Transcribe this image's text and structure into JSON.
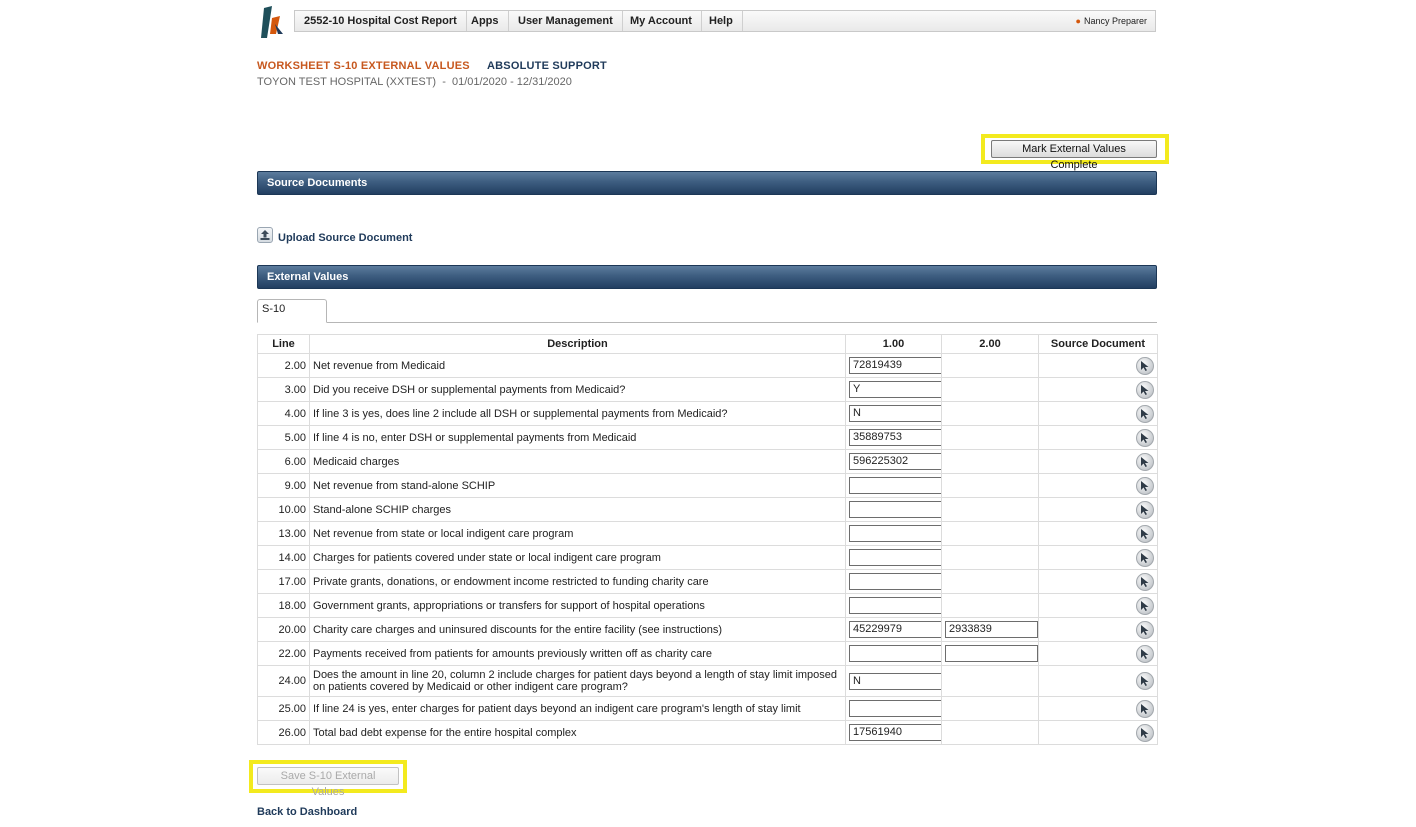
{
  "nav": {
    "app_title": "2552-10 Hospital Cost Report",
    "items": [
      "Apps",
      "User Management",
      "My Account",
      "Help"
    ],
    "user": "Nancy Preparer"
  },
  "header": {
    "worksheet_title": "WORKSHEET S-10 EXTERNAL VALUES",
    "subtitle": "ABSOLUTE SUPPORT",
    "hospital_line": "TOYON TEST HOSPITAL (XXTEST)  -  01/01/2020 - 12/31/2020"
  },
  "mark_complete_label": "Mark External Values Complete",
  "source_documents": {
    "title": "Source Documents",
    "upload_label": "Upload Source Document"
  },
  "external_values": {
    "title": "External Values",
    "tab_label": "S-10",
    "columns": [
      "Line",
      "Description",
      "1.00",
      "2.00",
      "Source Document"
    ],
    "rows": [
      {
        "line": "2.00",
        "desc": "Net revenue from Medicaid",
        "c1": "72819439",
        "c2": null
      },
      {
        "line": "3.00",
        "desc": "Did you receive DSH or supplemental payments from Medicaid?",
        "c1": "Y",
        "c2": null
      },
      {
        "line": "4.00",
        "desc": "If line 3 is yes, does line 2 include all DSH or supplemental payments from Medicaid?",
        "c1": "N",
        "c2": null
      },
      {
        "line": "5.00",
        "desc": "If line 4 is no, enter DSH or supplemental payments from Medicaid",
        "c1": "35889753",
        "c2": null
      },
      {
        "line": "6.00",
        "desc": "Medicaid charges",
        "c1": "596225302",
        "c2": null
      },
      {
        "line": "9.00",
        "desc": "Net revenue from stand-alone SCHIP",
        "c1": "",
        "c2": null
      },
      {
        "line": "10.00",
        "desc": "Stand-alone SCHIP charges",
        "c1": "",
        "c2": null
      },
      {
        "line": "13.00",
        "desc": "Net revenue from state or local indigent care program",
        "c1": "",
        "c2": null
      },
      {
        "line": "14.00",
        "desc": "Charges for patients covered under state or local indigent care program",
        "c1": "",
        "c2": null
      },
      {
        "line": "17.00",
        "desc": "Private grants, donations, or endowment income restricted to funding charity care",
        "c1": "",
        "c2": null
      },
      {
        "line": "18.00",
        "desc": "Government grants, appropriations or transfers for support of hospital operations",
        "c1": "",
        "c2": null
      },
      {
        "line": "20.00",
        "desc": "Charity care charges and uninsured discounts for the entire facility (see instructions)",
        "c1": "45229979",
        "c2": "2933839"
      },
      {
        "line": "22.00",
        "desc": "Payments received from patients for amounts previously written off as charity care",
        "c1": "",
        "c2": ""
      },
      {
        "line": "24.00",
        "desc": "Does the amount in line 20, column 2 include charges for patient days beyond a length of stay limit imposed on patients covered by Medicaid or other indigent care program?",
        "c1": "N",
        "c2": null
      },
      {
        "line": "25.00",
        "desc": "If line 24 is yes, enter charges for patient days beyond an indigent care program's length of stay limit",
        "c1": "",
        "c2": null
      },
      {
        "line": "26.00",
        "desc": "Total bad debt expense for the entire hospital complex",
        "c1": "17561940",
        "c2": null
      }
    ]
  },
  "save_label": "Save S-10 External Values",
  "back_link": "Back to Dashboard",
  "icons": {
    "logo": "toyon-logo-icon",
    "upload": "upload-icon",
    "source": "source-document-icon"
  },
  "colors": {
    "accent_orange": "#c7581f",
    "navy": "#1f3a5a",
    "highlight": "#f3ea1e"
  }
}
